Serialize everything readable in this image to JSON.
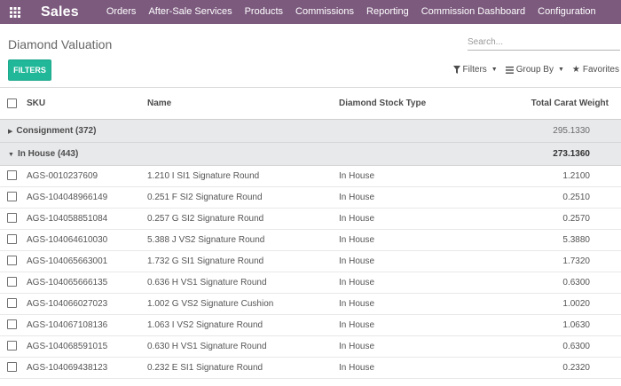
{
  "app": {
    "name": "Sales",
    "menu": [
      "Orders",
      "After-Sale Services",
      "Products",
      "Commissions",
      "Reporting",
      "Commission Dashboard",
      "Configuration"
    ]
  },
  "control_panel": {
    "title": "Diamond Valuation",
    "search_placeholder": "Search...",
    "filters_button": "FILTERS",
    "options": {
      "filters": "Filters",
      "group_by": "Group By",
      "favorites": "Favorites"
    }
  },
  "table": {
    "columns": [
      "SKU",
      "Name",
      "Diamond Stock Type",
      "Total Carat Weight"
    ],
    "groups": [
      {
        "label": "Consignment (372)",
        "total": "295.1330",
        "expanded": false
      },
      {
        "label": "In House (443)",
        "total": "273.1360",
        "expanded": true
      }
    ],
    "rows": [
      {
        "sku": "AGS-0010237609",
        "name": "1.210 I SI1 Signature Round",
        "type": "In House",
        "carat": "1.2100"
      },
      {
        "sku": "AGS-104048966149",
        "name": "0.251 F SI2 Signature Round",
        "type": "In House",
        "carat": "0.2510"
      },
      {
        "sku": "AGS-104058851084",
        "name": "0.257 G SI2 Signature Round",
        "type": "In House",
        "carat": "0.2570"
      },
      {
        "sku": "AGS-104064610030",
        "name": "5.388 J VS2 Signature Round",
        "type": "In House",
        "carat": "5.3880"
      },
      {
        "sku": "AGS-104065663001",
        "name": "1.732 G SI1 Signature Round",
        "type": "In House",
        "carat": "1.7320"
      },
      {
        "sku": "AGS-104065666135",
        "name": "0.636 H VS1 Signature Round",
        "type": "In House",
        "carat": "0.6300"
      },
      {
        "sku": "AGS-104066027023",
        "name": "1.002 G VS2 Signature Cushion",
        "type": "In House",
        "carat": "1.0020"
      },
      {
        "sku": "AGS-104067108136",
        "name": "1.063 I VS2 Signature Round",
        "type": "In House",
        "carat": "1.0630"
      },
      {
        "sku": "AGS-104068591015",
        "name": "0.630 H VS1 Signature Round",
        "type": "In House",
        "carat": "0.6300"
      },
      {
        "sku": "AGS-104069438123",
        "name": "0.232 E SI1 Signature Round",
        "type": "In House",
        "carat": "0.2320"
      }
    ]
  },
  "colors": {
    "navbar": "#7c5a7e",
    "primary_button": "#21b799",
    "group_row": "#e8e9eb"
  },
  "icons": {
    "apps": "grid-icon",
    "filters": "filter-icon",
    "group_by": "list-icon",
    "favorites": "star-icon",
    "collapsed": "caret-right-icon",
    "expanded": "caret-down-icon"
  }
}
